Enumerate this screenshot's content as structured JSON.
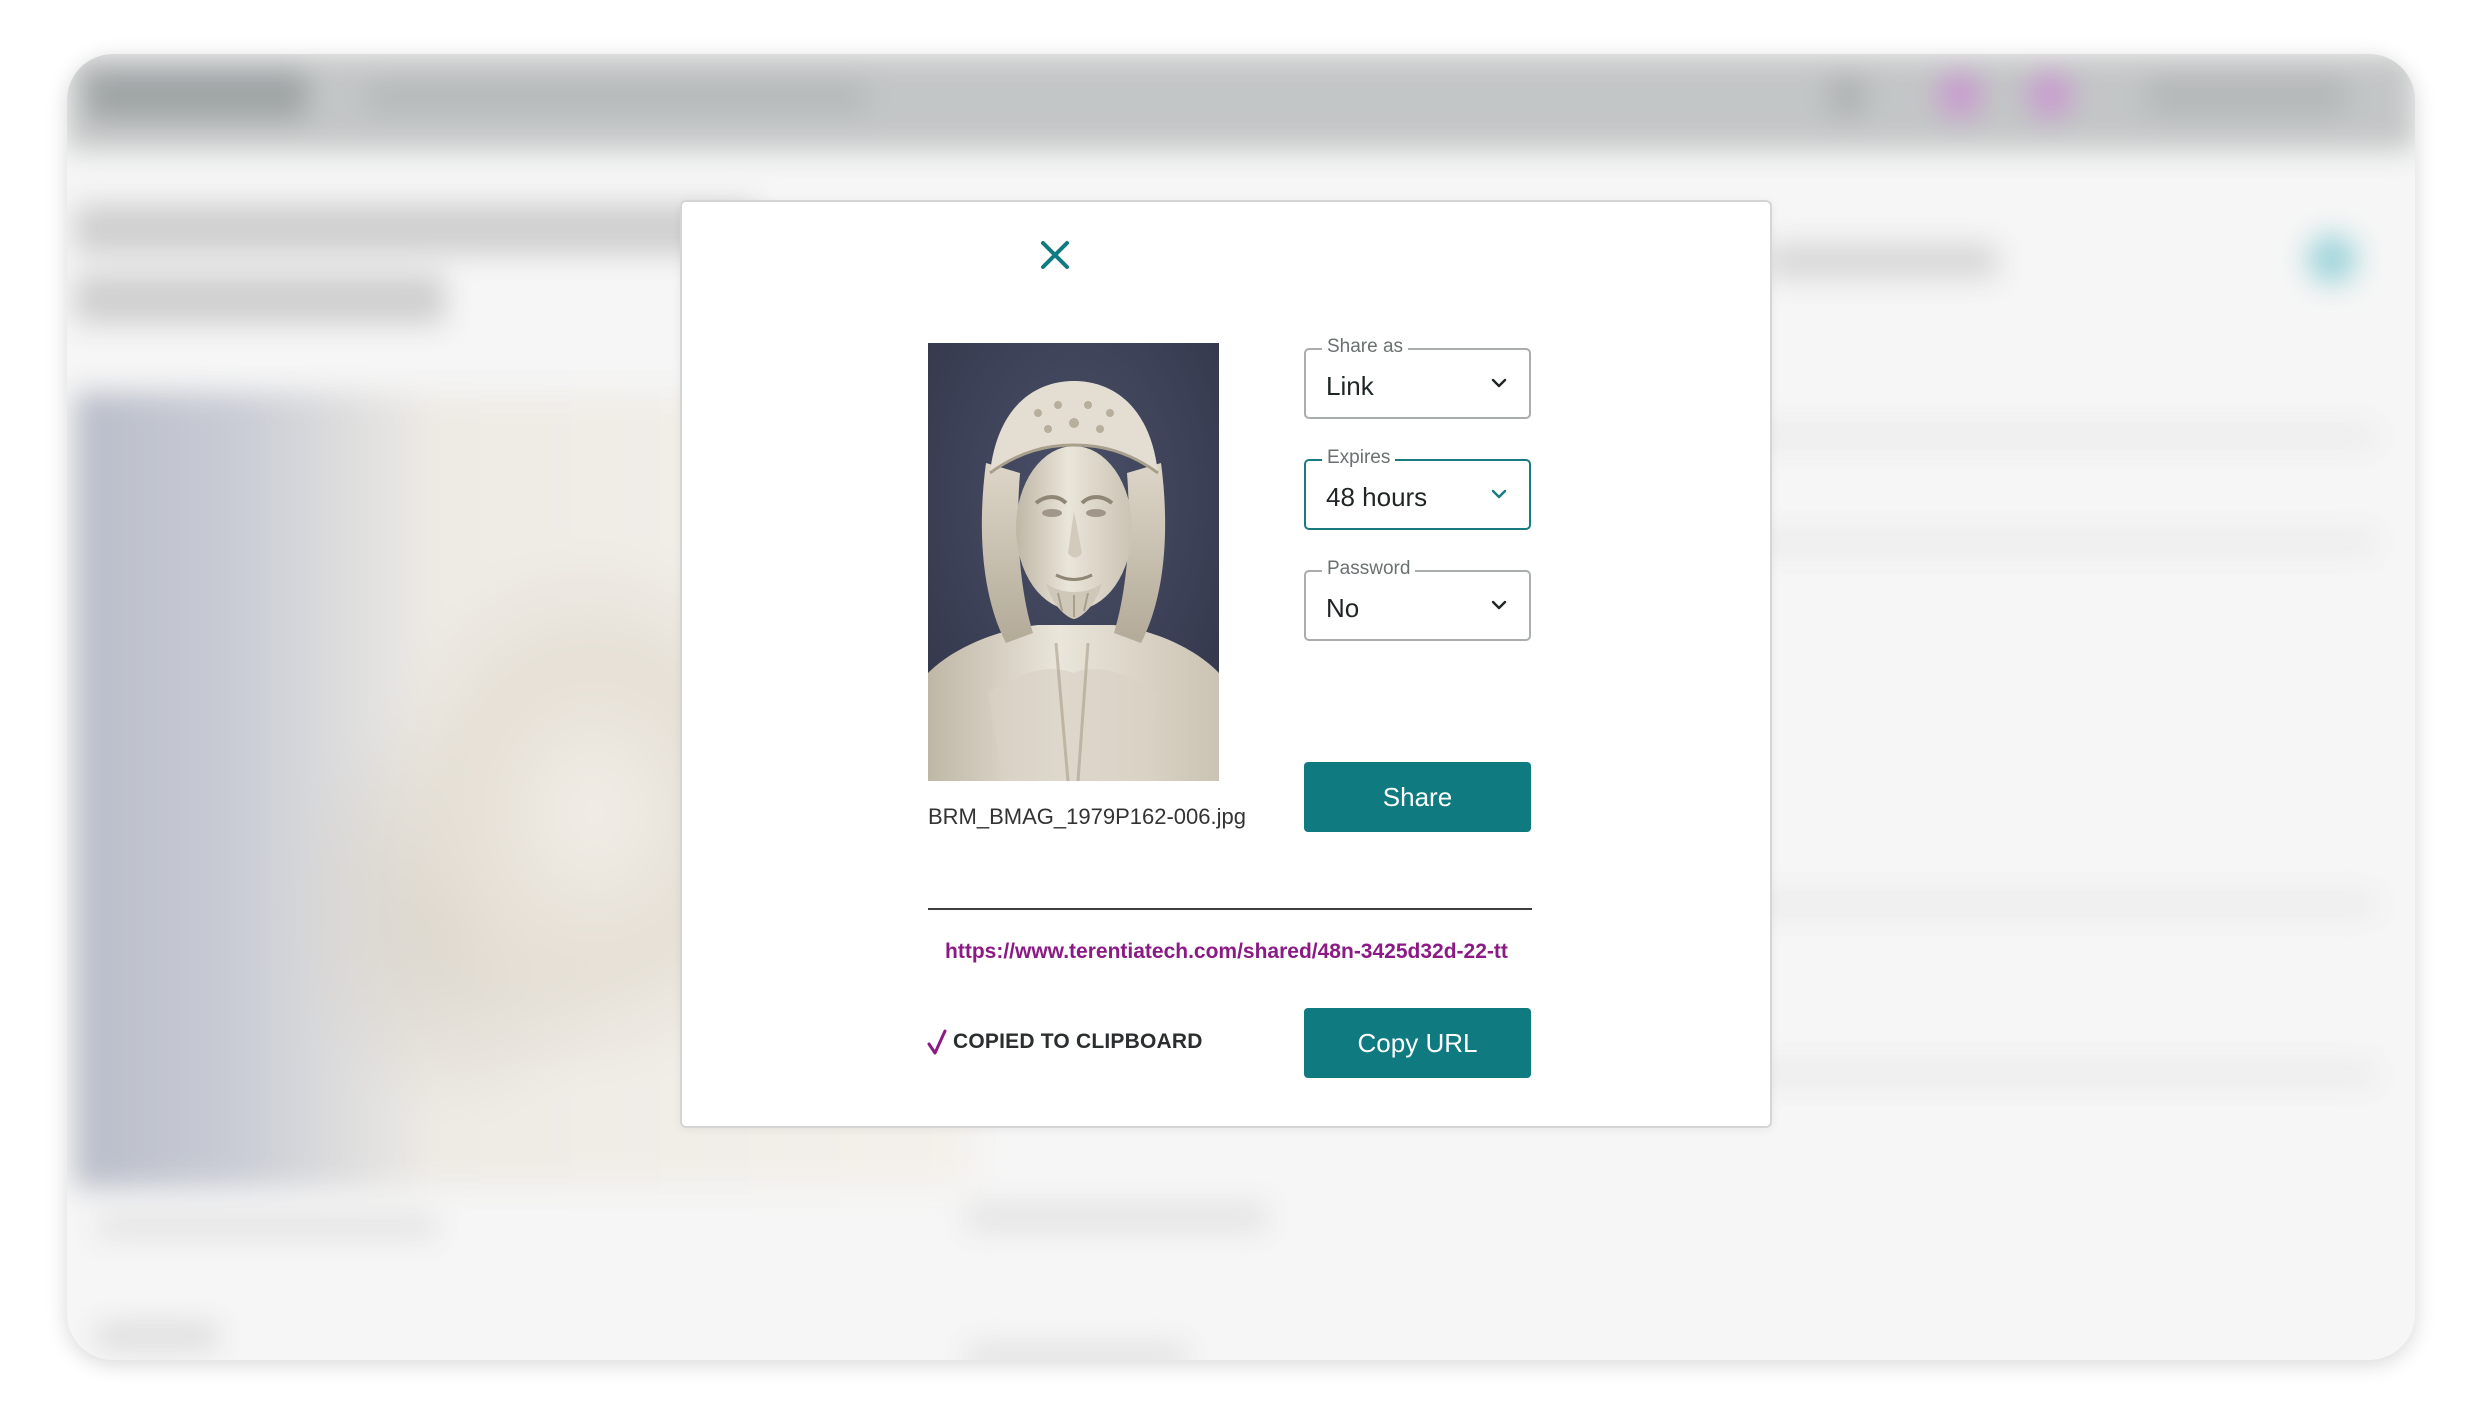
{
  "dialog": {
    "close_icon": "close-icon",
    "image": {
      "filename": "BRM_BMAG_1979P162-006.jpg",
      "subject": "marble bust portrait"
    },
    "share_as": {
      "label": "Share as",
      "value": "Link"
    },
    "expires": {
      "label": "Expires",
      "value": "48 hours"
    },
    "password": {
      "label": "Password",
      "value": "No"
    },
    "share_button": "Share",
    "share_url": "https://www.terentiatech.com/shared/48n-3425d32d-22-tt",
    "copied_status": "COPIED TO CLIPBOARD",
    "copy_button": "Copy URL"
  },
  "colors": {
    "accent": "#0f7a80",
    "focus_border": "#1a7a82",
    "link": "#8b1a85",
    "check": "#8b1a85"
  }
}
